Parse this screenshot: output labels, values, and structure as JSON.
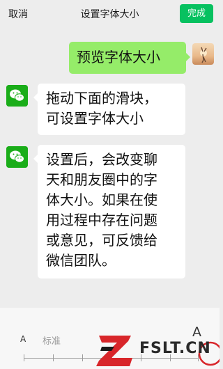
{
  "header": {
    "cancel_label": "取消",
    "title": "设置字体大小",
    "done_label": "完成"
  },
  "chat": {
    "my_message": "预览字体大小",
    "peer_message_1": [
      "拖动下面的滑块，",
      "可设置字体大小"
    ],
    "peer_message_2": [
      "设置后，会改变聊",
      "天和朋友圈中的字",
      "体大小。如果在使",
      "用过程中存在问题",
      "或意见，可反馈给",
      "微信团队。"
    ]
  },
  "font_slider": {
    "small_label": "A",
    "standard_label": "标准",
    "large_label": "A"
  },
  "watermark": {
    "text": "FSLT.CN"
  },
  "colors": {
    "accent": "#07c160",
    "my_bubble": "#95ec69",
    "background": "#ededed"
  },
  "icons": {
    "peer_avatar": "wechat-logo-icon",
    "my_avatar": "user-photo-avatar"
  }
}
